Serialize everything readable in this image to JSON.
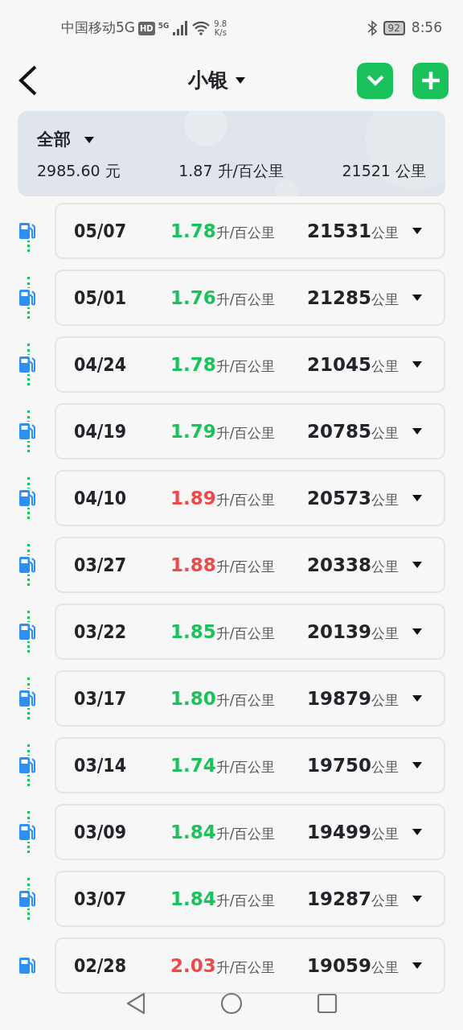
{
  "status_bar": {
    "carrier": "中国移动5G",
    "network_badge": "HD",
    "signal_label": "5G",
    "speed": "9.8",
    "speed_unit": "K/s",
    "battery": "92",
    "time": "8:56"
  },
  "header": {
    "title": "小银"
  },
  "summary": {
    "filter": "全部",
    "cost": "2985.60 元",
    "consumption": "1.87 升/百公里",
    "distance": "21521 公里"
  },
  "records": [
    {
      "date": "05/07",
      "consumption": "1.78",
      "unit": "升/百公里",
      "high": false,
      "odometer": "21531",
      "odometer_unit": "公里"
    },
    {
      "date": "05/01",
      "consumption": "1.76",
      "unit": "升/百公里",
      "high": false,
      "odometer": "21285",
      "odometer_unit": "公里"
    },
    {
      "date": "04/24",
      "consumption": "1.78",
      "unit": "升/百公里",
      "high": false,
      "odometer": "21045",
      "odometer_unit": "公里"
    },
    {
      "date": "04/19",
      "consumption": "1.79",
      "unit": "升/百公里",
      "high": false,
      "odometer": "20785",
      "odometer_unit": "公里"
    },
    {
      "date": "04/10",
      "consumption": "1.89",
      "unit": "升/百公里",
      "high": true,
      "odometer": "20573",
      "odometer_unit": "公里"
    },
    {
      "date": "03/27",
      "consumption": "1.88",
      "unit": "升/百公里",
      "high": true,
      "odometer": "20338",
      "odometer_unit": "公里"
    },
    {
      "date": "03/22",
      "consumption": "1.85",
      "unit": "升/百公里",
      "high": false,
      "odometer": "20139",
      "odometer_unit": "公里"
    },
    {
      "date": "03/17",
      "consumption": "1.80",
      "unit": "升/百公里",
      "high": false,
      "odometer": "19879",
      "odometer_unit": "公里"
    },
    {
      "date": "03/14",
      "consumption": "1.74",
      "unit": "升/百公里",
      "high": false,
      "odometer": "19750",
      "odometer_unit": "公里"
    },
    {
      "date": "03/09",
      "consumption": "1.84",
      "unit": "升/百公里",
      "high": false,
      "odometer": "19499",
      "odometer_unit": "公里"
    },
    {
      "date": "03/07",
      "consumption": "1.84",
      "unit": "升/百公里",
      "high": false,
      "odometer": "19287",
      "odometer_unit": "公里"
    },
    {
      "date": "02/28",
      "consumption": "2.03",
      "unit": "升/百公里",
      "high": true,
      "odometer": "19059",
      "odometer_unit": "公里"
    }
  ]
}
